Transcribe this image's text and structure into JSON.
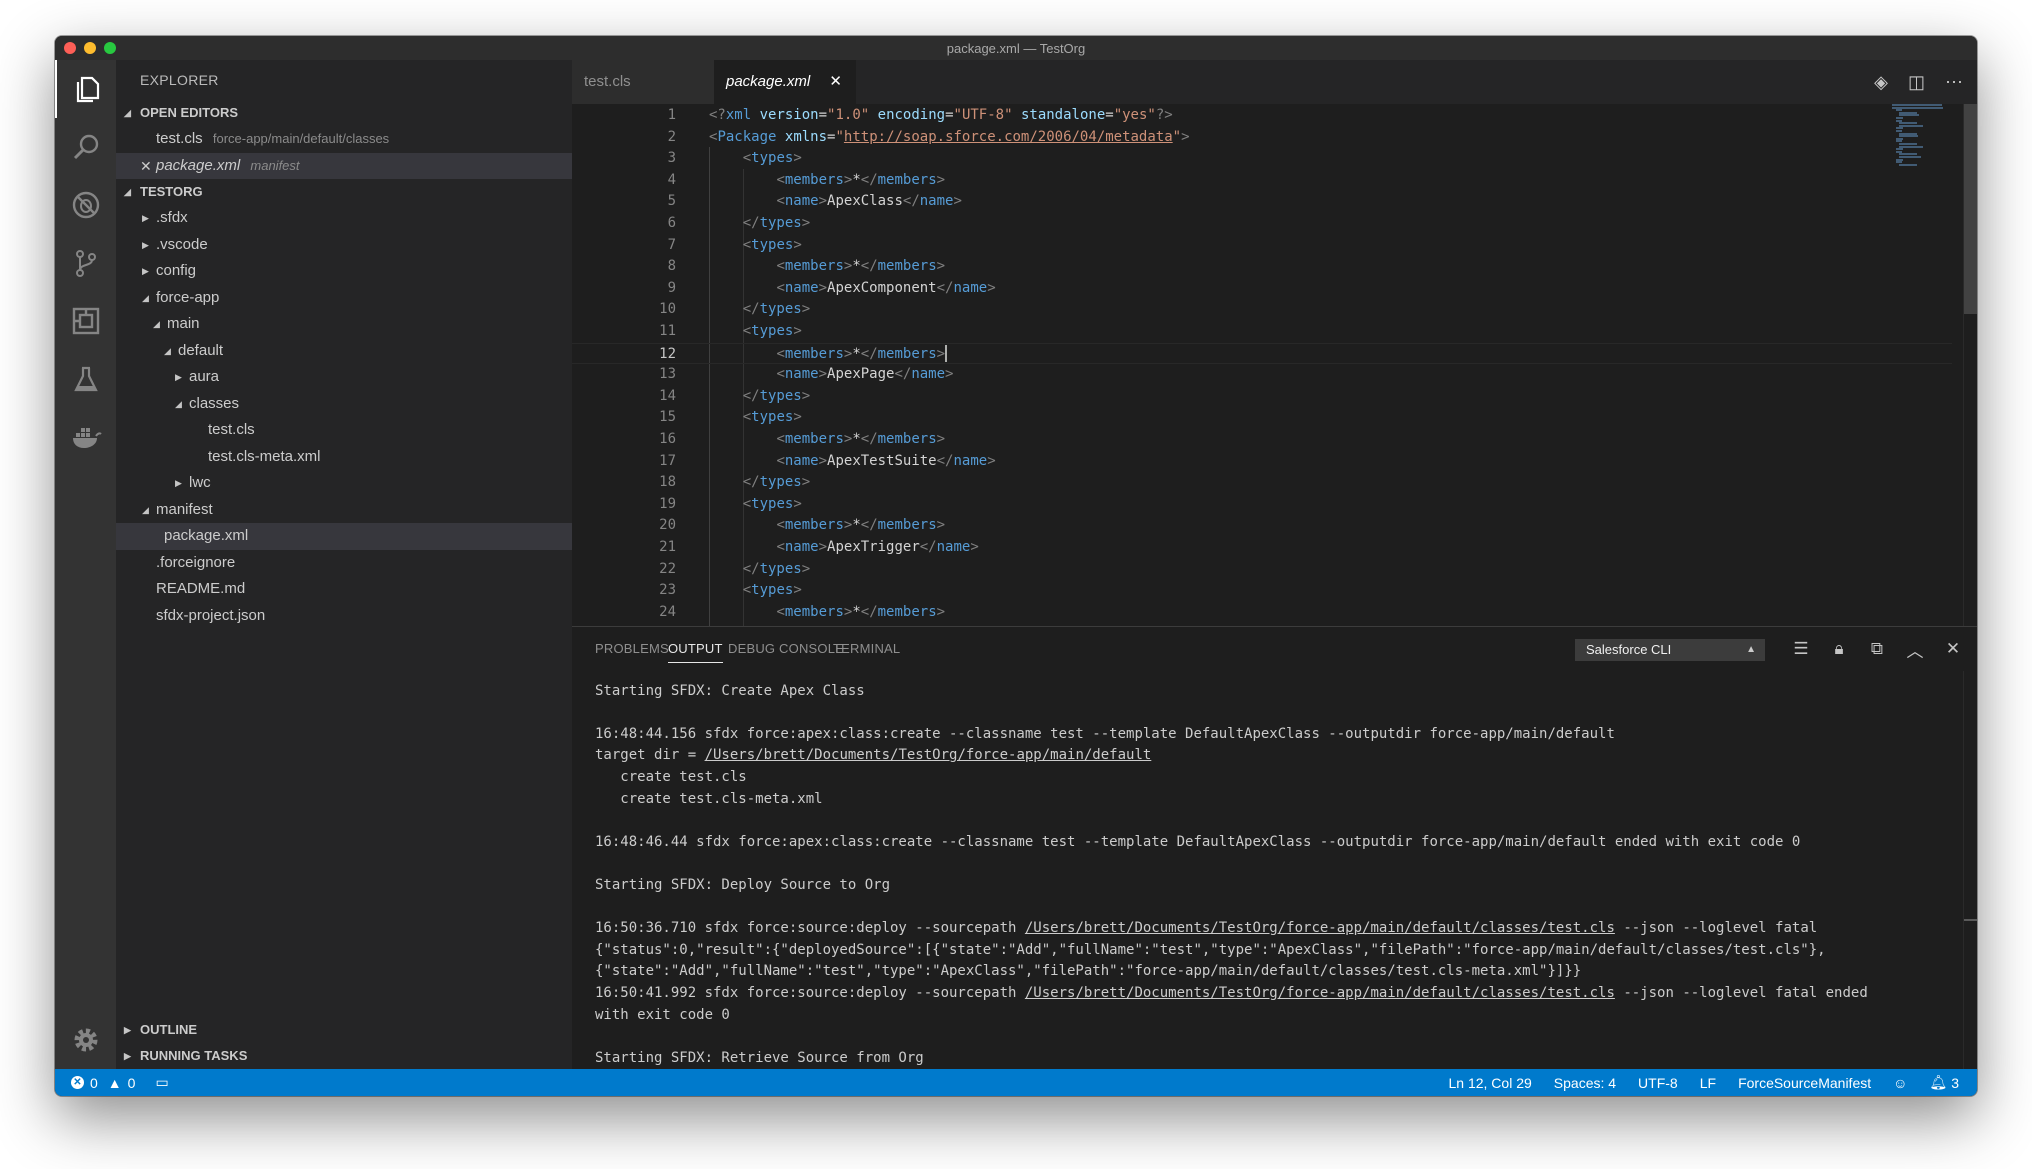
{
  "window": {
    "title": "package.xml — TestOrg"
  },
  "activity_bar": {
    "items": [
      {
        "icon": "files-icon"
      },
      {
        "icon": "search-icon"
      },
      {
        "icon": "debug-icon"
      },
      {
        "icon": "source-control-icon"
      },
      {
        "icon": "extensions-icon"
      },
      {
        "icon": "test-icon"
      },
      {
        "icon": "docker-icon"
      }
    ],
    "settings_icon": "gear-icon"
  },
  "sidebar": {
    "title": "EXPLORER",
    "open_editors": {
      "label": "OPEN EDITORS",
      "items": [
        {
          "name": "test.cls",
          "desc": "force-app/main/default/classes"
        },
        {
          "close": "✕",
          "name": "package.xml",
          "desc": "manifest"
        }
      ]
    },
    "project": {
      "label": "TESTORG",
      "tree": [
        {
          "label": ".sfdx",
          "twisty": "▶"
        },
        {
          "label": ".vscode",
          "twisty": "▶"
        },
        {
          "label": "config",
          "twisty": "▶"
        },
        {
          "label": "force-app",
          "twisty": "◢"
        },
        {
          "label": "main",
          "twisty": "◢"
        },
        {
          "label": "default",
          "twisty": "◢"
        },
        {
          "label": "aura",
          "twisty": "▶"
        },
        {
          "label": "classes",
          "twisty": "◢"
        },
        {
          "label": "test.cls",
          "twisty": ""
        },
        {
          "label": "test.cls-meta.xml",
          "twisty": ""
        },
        {
          "label": "lwc",
          "twisty": "▶"
        },
        {
          "label": "manifest",
          "twisty": "◢"
        },
        {
          "label": "package.xml",
          "twisty": ""
        },
        {
          "label": ".forceignore",
          "twisty": ""
        },
        {
          "label": "README.md",
          "twisty": ""
        },
        {
          "label": "sfdx-project.json",
          "twisty": ""
        }
      ]
    },
    "outline": {
      "label": "OUTLINE"
    },
    "running_tasks": {
      "label": "RUNNING TASKS"
    }
  },
  "editor": {
    "tabs": [
      {
        "label": "test.cls",
        "active": false
      },
      {
        "label": "package.xml",
        "active": true,
        "close": "✕"
      }
    ],
    "actions": [
      "◈",
      "◫",
      "⋯"
    ],
    "current_line": 12,
    "lines": [
      {
        "n": "1",
        "tokens": [
          [
            "pun",
            "<?"
          ],
          [
            "tag",
            "xml"
          ],
          [
            "txt",
            " "
          ],
          [
            "attr",
            "version"
          ],
          [
            "txt",
            "="
          ],
          [
            "str",
            "\"1.0\""
          ],
          [
            "txt",
            " "
          ],
          [
            "attr",
            "encoding"
          ],
          [
            "txt",
            "="
          ],
          [
            "str",
            "\"UTF-8\""
          ],
          [
            "txt",
            " "
          ],
          [
            "attr",
            "standalone"
          ],
          [
            "txt",
            "="
          ],
          [
            "str",
            "\"yes\""
          ],
          [
            "pun",
            "?>"
          ]
        ]
      },
      {
        "n": "2",
        "tokens": [
          [
            "pun",
            "<"
          ],
          [
            "tag",
            "Package"
          ],
          [
            "txt",
            " "
          ],
          [
            "attr",
            "xmlns"
          ],
          [
            "txt",
            "="
          ],
          [
            "str",
            "\""
          ],
          [
            "url",
            "http://soap.sforce.com/2006/04/metadata"
          ],
          [
            "str",
            "\""
          ],
          [
            "pun",
            ">"
          ]
        ]
      },
      {
        "n": "3",
        "tokens": [
          [
            "txt",
            "    "
          ],
          [
            "pun",
            "<"
          ],
          [
            "tag",
            "types"
          ],
          [
            "pun",
            ">"
          ]
        ]
      },
      {
        "n": "4",
        "tokens": [
          [
            "txt",
            "        "
          ],
          [
            "pun",
            "<"
          ],
          [
            "tag",
            "members"
          ],
          [
            "pun",
            ">"
          ],
          [
            "txt",
            "*"
          ],
          [
            "pun",
            "</"
          ],
          [
            "tag",
            "members"
          ],
          [
            "pun",
            ">"
          ]
        ]
      },
      {
        "n": "5",
        "tokens": [
          [
            "txt",
            "        "
          ],
          [
            "pun",
            "<"
          ],
          [
            "tag",
            "name"
          ],
          [
            "pun",
            ">"
          ],
          [
            "txt",
            "ApexClass"
          ],
          [
            "pun",
            "</"
          ],
          [
            "tag",
            "name"
          ],
          [
            "pun",
            ">"
          ]
        ]
      },
      {
        "n": "6",
        "tokens": [
          [
            "txt",
            "    "
          ],
          [
            "pun",
            "</"
          ],
          [
            "tag",
            "types"
          ],
          [
            "pun",
            ">"
          ]
        ]
      },
      {
        "n": "7",
        "tokens": [
          [
            "txt",
            "    "
          ],
          [
            "pun",
            "<"
          ],
          [
            "tag",
            "types"
          ],
          [
            "pun",
            ">"
          ]
        ]
      },
      {
        "n": "8",
        "tokens": [
          [
            "txt",
            "        "
          ],
          [
            "pun",
            "<"
          ],
          [
            "tag",
            "members"
          ],
          [
            "pun",
            ">"
          ],
          [
            "txt",
            "*"
          ],
          [
            "pun",
            "</"
          ],
          [
            "tag",
            "members"
          ],
          [
            "pun",
            ">"
          ]
        ]
      },
      {
        "n": "9",
        "tokens": [
          [
            "txt",
            "        "
          ],
          [
            "pun",
            "<"
          ],
          [
            "tag",
            "name"
          ],
          [
            "pun",
            ">"
          ],
          [
            "txt",
            "ApexComponent"
          ],
          [
            "pun",
            "</"
          ],
          [
            "tag",
            "name"
          ],
          [
            "pun",
            ">"
          ]
        ]
      },
      {
        "n": "10",
        "tokens": [
          [
            "txt",
            "    "
          ],
          [
            "pun",
            "</"
          ],
          [
            "tag",
            "types"
          ],
          [
            "pun",
            ">"
          ]
        ]
      },
      {
        "n": "11",
        "tokens": [
          [
            "txt",
            "    "
          ],
          [
            "pun",
            "<"
          ],
          [
            "tag",
            "types"
          ],
          [
            "pun",
            ">"
          ]
        ]
      },
      {
        "n": "12",
        "tokens": [
          [
            "txt",
            "        "
          ],
          [
            "pun",
            "<"
          ],
          [
            "tag",
            "members"
          ],
          [
            "pun",
            ">"
          ],
          [
            "txt",
            "*"
          ],
          [
            "pun",
            "</"
          ],
          [
            "tag",
            "members"
          ],
          [
            "pun",
            ">"
          ]
        ]
      },
      {
        "n": "13",
        "tokens": [
          [
            "txt",
            "        "
          ],
          [
            "pun",
            "<"
          ],
          [
            "tag",
            "name"
          ],
          [
            "pun",
            ">"
          ],
          [
            "txt",
            "ApexPage"
          ],
          [
            "pun",
            "</"
          ],
          [
            "tag",
            "name"
          ],
          [
            "pun",
            ">"
          ]
        ]
      },
      {
        "n": "14",
        "tokens": [
          [
            "txt",
            "    "
          ],
          [
            "pun",
            "</"
          ],
          [
            "tag",
            "types"
          ],
          [
            "pun",
            ">"
          ]
        ]
      },
      {
        "n": "15",
        "tokens": [
          [
            "txt",
            "    "
          ],
          [
            "pun",
            "<"
          ],
          [
            "tag",
            "types"
          ],
          [
            "pun",
            ">"
          ]
        ]
      },
      {
        "n": "16",
        "tokens": [
          [
            "txt",
            "        "
          ],
          [
            "pun",
            "<"
          ],
          [
            "tag",
            "members"
          ],
          [
            "pun",
            ">"
          ],
          [
            "txt",
            "*"
          ],
          [
            "pun",
            "</"
          ],
          [
            "tag",
            "members"
          ],
          [
            "pun",
            ">"
          ]
        ]
      },
      {
        "n": "17",
        "tokens": [
          [
            "txt",
            "        "
          ],
          [
            "pun",
            "<"
          ],
          [
            "tag",
            "name"
          ],
          [
            "pun",
            ">"
          ],
          [
            "txt",
            "ApexTestSuite"
          ],
          [
            "pun",
            "</"
          ],
          [
            "tag",
            "name"
          ],
          [
            "pun",
            ">"
          ]
        ]
      },
      {
        "n": "18",
        "tokens": [
          [
            "txt",
            "    "
          ],
          [
            "pun",
            "</"
          ],
          [
            "tag",
            "types"
          ],
          [
            "pun",
            ">"
          ]
        ]
      },
      {
        "n": "19",
        "tokens": [
          [
            "txt",
            "    "
          ],
          [
            "pun",
            "<"
          ],
          [
            "tag",
            "types"
          ],
          [
            "pun",
            ">"
          ]
        ]
      },
      {
        "n": "20",
        "tokens": [
          [
            "txt",
            "        "
          ],
          [
            "pun",
            "<"
          ],
          [
            "tag",
            "members"
          ],
          [
            "pun",
            ">"
          ],
          [
            "txt",
            "*"
          ],
          [
            "pun",
            "</"
          ],
          [
            "tag",
            "members"
          ],
          [
            "pun",
            ">"
          ]
        ]
      },
      {
        "n": "21",
        "tokens": [
          [
            "txt",
            "        "
          ],
          [
            "pun",
            "<"
          ],
          [
            "tag",
            "name"
          ],
          [
            "pun",
            ">"
          ],
          [
            "txt",
            "ApexTrigger"
          ],
          [
            "pun",
            "</"
          ],
          [
            "tag",
            "name"
          ],
          [
            "pun",
            ">"
          ]
        ]
      },
      {
        "n": "22",
        "tokens": [
          [
            "txt",
            "    "
          ],
          [
            "pun",
            "</"
          ],
          [
            "tag",
            "types"
          ],
          [
            "pun",
            ">"
          ]
        ]
      },
      {
        "n": "23",
        "tokens": [
          [
            "txt",
            "    "
          ],
          [
            "pun",
            "<"
          ],
          [
            "tag",
            "types"
          ],
          [
            "pun",
            ">"
          ]
        ]
      },
      {
        "n": "24",
        "tokens": [
          [
            "txt",
            "        "
          ],
          [
            "pun",
            "<"
          ],
          [
            "tag",
            "members"
          ],
          [
            "pun",
            ">"
          ],
          [
            "txt",
            "*"
          ],
          [
            "pun",
            "</"
          ],
          [
            "tag",
            "members"
          ],
          [
            "pun",
            ">"
          ]
        ]
      }
    ]
  },
  "panel": {
    "tabs": [
      {
        "label": "PROBLEMS",
        "active": false
      },
      {
        "label": "OUTPUT",
        "active": true
      },
      {
        "label": "DEBUG CONSOLE",
        "active": false
      },
      {
        "label": "TERMINAL",
        "active": false
      }
    ],
    "channel": "Salesforce CLI",
    "actions": [
      {
        "icon": "clear-output-icon",
        "glyph": "☰"
      },
      {
        "icon": "lock-icon",
        "glyph": "🔒︎"
      },
      {
        "icon": "open-log-icon",
        "glyph": "⧉"
      },
      {
        "icon": "chevron-up-icon",
        "glyph": "︿"
      },
      {
        "icon": "close-icon",
        "glyph": "✕"
      }
    ],
    "output_lines": [
      [
        [
          "",
          ""
        ]
      ],
      [
        [
          "",
          "Starting SFDX: Create Apex Class"
        ]
      ],
      [
        [
          "",
          ""
        ]
      ],
      [
        [
          "",
          "16:48:44.156 sfdx force:apex:class:create --classname test --template DefaultApexClass --outputdir force-app/main/default"
        ]
      ],
      [
        [
          "",
          "target dir = "
        ],
        [
          "link",
          "/Users/brett/Documents/TestOrg/force-app/main/default"
        ]
      ],
      [
        [
          "",
          "   create test.cls"
        ]
      ],
      [
        [
          "",
          "   create test.cls-meta.xml"
        ]
      ],
      [
        [
          "",
          ""
        ]
      ],
      [
        [
          "",
          "16:48:46.44 sfdx force:apex:class:create --classname test --template DefaultApexClass --outputdir force-app/main/default ended with exit code 0"
        ]
      ],
      [
        [
          "",
          ""
        ]
      ],
      [
        [
          "",
          "Starting SFDX: Deploy Source to Org"
        ]
      ],
      [
        [
          "",
          ""
        ]
      ],
      [
        [
          "",
          "16:50:36.710 sfdx force:source:deploy --sourcepath "
        ],
        [
          "link",
          "/Users/brett/Documents/TestOrg/force-app/main/default/classes/test.cls"
        ],
        [
          "",
          " --json --loglevel fatal"
        ]
      ],
      [
        [
          "",
          "{\"status\":0,\"result\":{\"deployedSource\":[{\"state\":\"Add\",\"fullName\":\"test\",\"type\":\"ApexClass\",\"filePath\":\"force-app/main/default/classes/test.cls\"},"
        ]
      ],
      [
        [
          "",
          "{\"state\":\"Add\",\"fullName\":\"test\",\"type\":\"ApexClass\",\"filePath\":\"force-app/main/default/classes/test.cls-meta.xml\"}]}}"
        ]
      ],
      [
        [
          "",
          "16:50:41.992 sfdx force:source:deploy --sourcepath "
        ],
        [
          "link",
          "/Users/brett/Documents/TestOrg/force-app/main/default/classes/test.cls"
        ],
        [
          "",
          " --json --loglevel fatal ended"
        ]
      ],
      [
        [
          "",
          "with exit code 0"
        ]
      ],
      [
        [
          "",
          ""
        ]
      ],
      [
        [
          "",
          "Starting SFDX: Retrieve Source from Org"
        ]
      ]
    ]
  },
  "statusbar": {
    "errors": "0",
    "warnings": "0",
    "position": "Ln 12, Col 29",
    "spaces": "Spaces: 4",
    "encoding": "UTF-8",
    "eol": "LF",
    "context": "ForceSourceManifest",
    "notifications": "3"
  },
  "colors": {
    "statusbar": "#007acc",
    "activitybar": "#333333",
    "sidebar": "#252526",
    "editor": "#1e1e1e"
  }
}
